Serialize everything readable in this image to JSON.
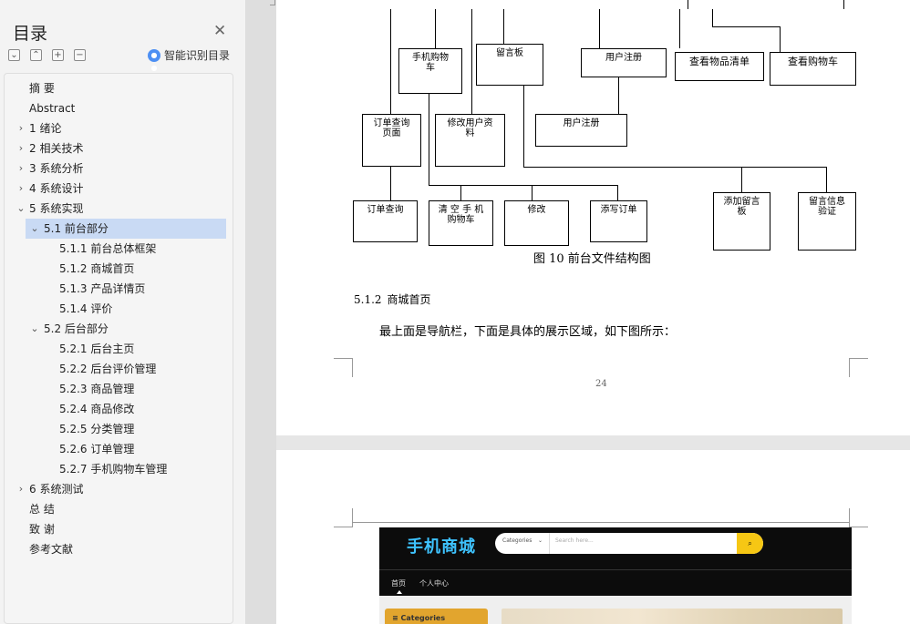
{
  "sidebar": {
    "title": "目录",
    "smart_toc_label": "智能识别目录",
    "items": [
      {
        "label": "摘  要"
      },
      {
        "label": "Abstract"
      },
      {
        "label": "1 绪论"
      },
      {
        "label": "2 相关技术"
      },
      {
        "label": "3 系统分析"
      },
      {
        "label": "4 系统设计"
      },
      {
        "label": "5 系统实现"
      },
      {
        "label": "5.1  前台部分"
      },
      {
        "label": "5.1.1  前台总体框架"
      },
      {
        "label": "5.1.2  商城首页"
      },
      {
        "label": "5.1.3  产品详情页"
      },
      {
        "label": "5.1.4  评价"
      },
      {
        "label": "5.2  后台部分"
      },
      {
        "label": "5.2.1  后台主页"
      },
      {
        "label": "5.2.2  后台评价管理"
      },
      {
        "label": "5.2.3  商品管理"
      },
      {
        "label": "5.2.4  商品修改"
      },
      {
        "label": "5.2.5  分类管理"
      },
      {
        "label": "5.2.6  订单管理"
      },
      {
        "label": "5.2.7  手机购物车管理"
      },
      {
        "label": "6 系统测试"
      },
      {
        "label": "总    结"
      },
      {
        "label": "致    谢"
      },
      {
        "label": "参考文献"
      }
    ]
  },
  "diagram": {
    "nodes": {
      "phone_cart": "手机购物\n车",
      "message_board": "留言板",
      "user_register_top": "用户注册",
      "view_items_list": "查看物品清单",
      "view_cart": "查看购物车",
      "order_query_page": "订单查询\n页面",
      "edit_user_info": "修改用户资\n料",
      "user_register_mid": "用户注册",
      "order_query": "订单查询",
      "clear_cart": "清 空 手 机\n购物车",
      "modify": "修改",
      "fill_order": "添写订单",
      "add_message": "添加留言\n板",
      "message_verify": "留言信息\n验证"
    },
    "caption": "图 10    前台文件结构图"
  },
  "document": {
    "section_number": "5.1.2",
    "section_title": "商城首页",
    "paragraph": "最上面是导航栏，下面是具体的展示区域，如下图所示：",
    "page_number": "24"
  },
  "shop_screenshot": {
    "logo": "手机商城",
    "category_select": "Categories",
    "search_placeholder": "Search here...",
    "nav_home": "首页",
    "nav_user_center": "个人中心",
    "categories_heading": "Categories",
    "colors": {
      "logo": "#3ec3ff",
      "search_button": "#f6c714",
      "categories_bar": "#e2a52e"
    }
  },
  "colors": {
    "selected_toc_bg": "#c9daf4",
    "smart_toc_icon": "#4d8ff3"
  }
}
